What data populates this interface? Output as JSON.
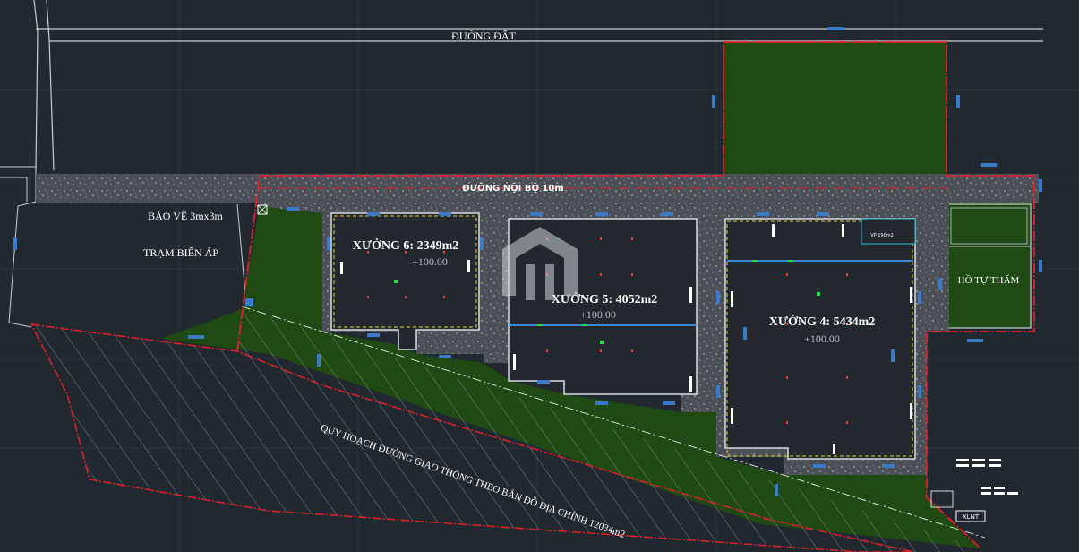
{
  "labels": {
    "road_top": "ĐƯỜNG ĐẤT",
    "road_internal": "ĐƯỜNG NỘI BỘ 10m",
    "guard_house": "BẢO VỆ 3mx3m",
    "substation": "TRẠM BIẾN ÁP",
    "pond": "HỒ TỰ THẤM",
    "planning_note": "QUY HOẠCH ĐƯỜNG GIAO THÔNG THEO BẢN ĐỒ ĐỊA CHÍNH  12034m2",
    "office": "VP 190m2",
    "waste_treatment": "XLNT"
  },
  "workshops": [
    {
      "name": "XƯỞNG 6: 2349m2",
      "elevation": "+100.00"
    },
    {
      "name": "XƯỞNG 5: 4052m2",
      "elevation": "+100.00"
    },
    {
      "name": "XƯỞNG 4: 5434m2",
      "elevation": "+100.00"
    }
  ],
  "colors": {
    "background": "#212830",
    "boundary": "#e0202a",
    "green_area": "#1f4a14",
    "gravel": "#4d5258",
    "slab": "#22282e",
    "dimension": "#3b79c9"
  }
}
